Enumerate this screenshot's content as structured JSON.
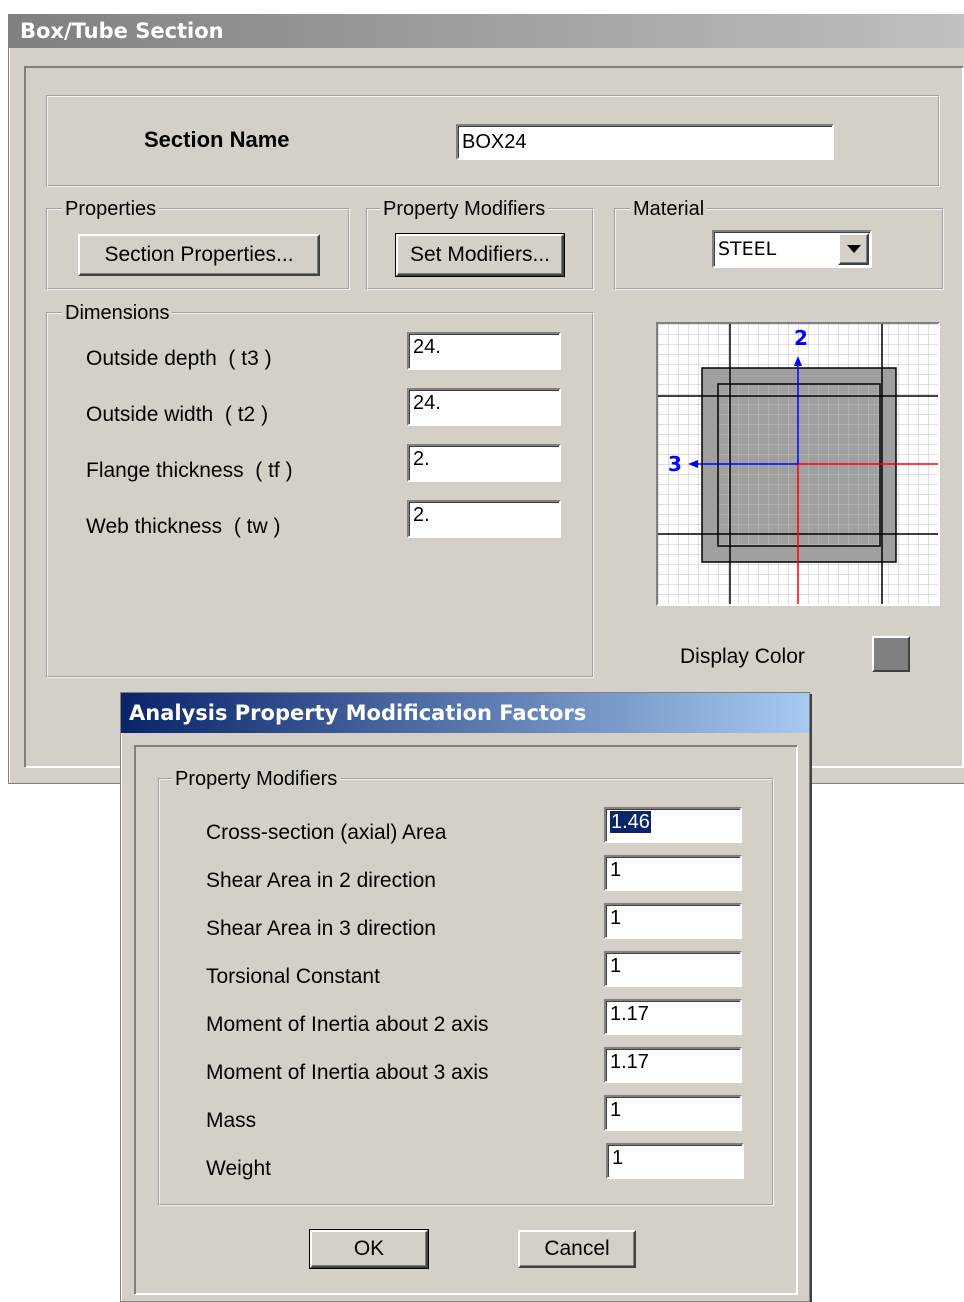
{
  "outer_dialog": {
    "title": "Box/Tube Section",
    "section_name_label": "Section Name",
    "section_name_value": "BOX24",
    "properties_legend": "Properties",
    "section_properties_button": "Section Properties...",
    "property_modifiers_legend": "Property Modifiers",
    "set_modifiers_button": "Set Modifiers...",
    "material_legend": "Material",
    "material_value": "STEEL",
    "dimensions_legend": "Dimensions",
    "dimensions": [
      {
        "label": "Outside depth  ( t3 )",
        "value": "24."
      },
      {
        "label": "Outside width  ( t2 )",
        "value": "24."
      },
      {
        "label": "Flange thickness  ( tf )",
        "value": "2."
      },
      {
        "label": "Web thickness  ( tw )",
        "value": "2."
      }
    ],
    "preview_axis_2": "2",
    "preview_axis_3": "3",
    "display_color_label": "Display Color",
    "display_color": "#808080"
  },
  "modal_dialog": {
    "title": "Analysis Property Modification Factors",
    "legend": "Property Modifiers",
    "rows": [
      {
        "label": "Cross-section (axial) Area",
        "value": "1.46"
      },
      {
        "label": "Shear Area in 2 direction",
        "value": "1"
      },
      {
        "label": "Shear Area in 3 direction",
        "value": "1"
      },
      {
        "label": "Torsional Constant",
        "value": "1"
      },
      {
        "label": "Moment of Inertia about 2 axis",
        "value": "1.17"
      },
      {
        "label": "Moment of Inertia about 3 axis",
        "value": "1.17"
      },
      {
        "label": "Mass",
        "value": "1"
      },
      {
        "label": "Weight",
        "value": "1"
      }
    ],
    "ok_button": "OK",
    "cancel_button": "Cancel"
  },
  "colors": {
    "dialog_face": "#d4d0c8",
    "active_title_start": "#0a246a",
    "active_title_end": "#a6caf0",
    "inactive_title_start": "#808080",
    "axis_2_color": "#0000ff",
    "axis_3_color": "#ff0000"
  }
}
